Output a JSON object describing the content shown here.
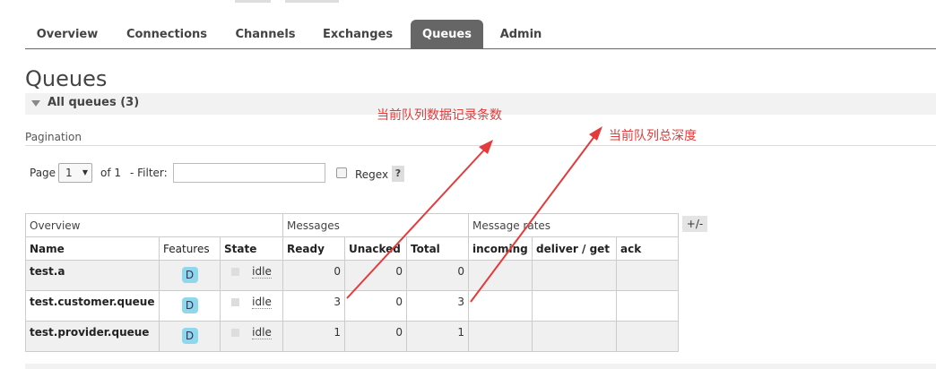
{
  "nav": {
    "tabs": [
      {
        "label": "Overview"
      },
      {
        "label": "Connections"
      },
      {
        "label": "Channels"
      },
      {
        "label": "Exchanges"
      },
      {
        "label": "Queues",
        "active": true
      },
      {
        "label": "Admin"
      }
    ]
  },
  "page": {
    "title": "Queues",
    "section_title": "All queues (3)"
  },
  "pagination": {
    "label": "Pagination",
    "page_label": "Page",
    "page_value": "1",
    "of_label": "of 1",
    "filter_label": "- Filter:",
    "filter_value": "",
    "regex_label": "Regex",
    "regex_checked": false,
    "help_label": "?"
  },
  "table": {
    "groups": {
      "overview": "Overview",
      "messages": "Messages",
      "rates": "Message rates"
    },
    "columns": {
      "name": "Name",
      "features": "Features",
      "state": "State",
      "ready": "Ready",
      "unacked": "Unacked",
      "total": "Total",
      "incoming": "incoming",
      "deliver": "deliver / get",
      "ack": "ack"
    },
    "rows": [
      {
        "name": "test.a",
        "feature": "D",
        "state": "idle",
        "ready": "0",
        "unacked": "0",
        "total": "0"
      },
      {
        "name": "test.customer.queue",
        "feature": "D",
        "state": "idle",
        "ready": "3",
        "unacked": "0",
        "total": "3"
      },
      {
        "name": "test.provider.queue",
        "feature": "D",
        "state": "idle",
        "ready": "1",
        "unacked": "0",
        "total": "1"
      }
    ],
    "toggle_label": "+/-"
  },
  "annotations": {
    "ready_note": "当前队列数据记录条数",
    "total_note": "当前队列总深度",
    "color": "#e23b3b"
  },
  "colors": {
    "active_tab": "#666666",
    "feature_badge": "#8ed8ee"
  }
}
